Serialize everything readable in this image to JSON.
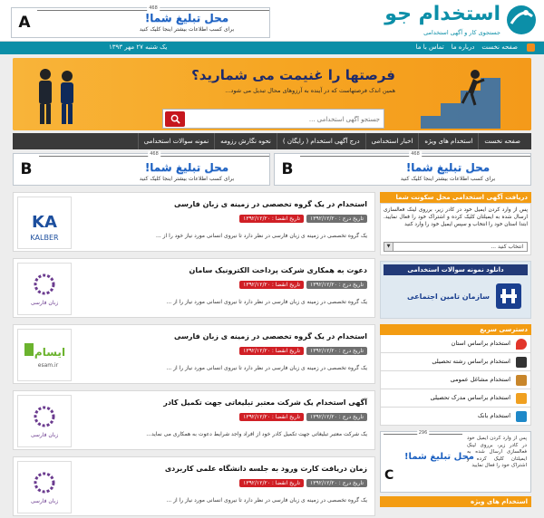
{
  "header": {
    "site_title": "استخدام جو",
    "site_subtitle": "جستجوی کار و آگهی استخدامی",
    "ad_a": {
      "letter": "A",
      "width_label": "468",
      "title": "محل تبلیغ شما!",
      "note": "برای کسب اطلاعات بیشتر اینجا کلیک کنید"
    }
  },
  "strip": {
    "links": [
      "صفحه نخست",
      "درباره ما",
      "تماس با ما"
    ],
    "date": "یک شنبه ۲۷ مهر ۱۳۹۳"
  },
  "hero": {
    "headline": "فرصتها را غنیمت می شمارید؟",
    "sub": "همین اندک فرصتهاست که در آینده به آرزوهای محال تبدیل می شود...",
    "search_placeholder": "جستجو آگهی استخدامی ..."
  },
  "nav": [
    "صفحه نخست",
    "استخدام های ویژه",
    "اخبار استخدامی",
    "درج آگهی استخدام ( رایگان )",
    "نحوه نگارش رزومه",
    "نمونه سوالات استخدامی"
  ],
  "ads_b": [
    {
      "letter": "B",
      "width_label": "468",
      "title": "محل تبلیغ شما!",
      "note": "برای کسب اطلاعات بیشتر اینجا کلیک کنید"
    },
    {
      "letter": "B",
      "width_label": "468",
      "title": "محل تبلیغ شما!",
      "note": "برای کسب اطلاعات بیشتر اینجا کلیک کنید"
    }
  ],
  "listings": [
    {
      "title": "استخدام در یک گروه تخصصی در زمینه ی زبان فارسی",
      "date_label": "تاریخ درج : ۱۳۹۲/۱۲/۲۰",
      "expire_label": "تاریخ انقضا : ۱۳۹۲/۱۲/۲۰",
      "desc": "یک گروه تخصصی در زمینه ی زبان فارسی در نظر دارد تا نیروی انسانی مورد نیاز خود را از ...",
      "logo": "KALBER"
    },
    {
      "title": "دعوت به همکاری شرکت پرداخت الکترونیک سامان",
      "date_label": "تاریخ درج : ۱۳۹۲/۱۲/۲۰",
      "expire_label": "تاریخ انقضا : ۱۳۹۲/۱۲/۲۰",
      "desc": "یک گروه تخصصی در زمینه ی زبان فارسی در نظر دارد تا نیروی انسانی مورد نیاز را از ...",
      "logo": "زبان فارسی"
    },
    {
      "title": "استخدام در یک گروه تخصصی در زمینه ی زبان فارسی",
      "date_label": "تاریخ درج : ۱۳۹۲/۱۲/۲۰",
      "expire_label": "تاریخ انقضا : ۱۳۹۲/۱۲/۲۰",
      "desc": "یک گروه تخصصی در زمینه ی زبان فارسی در نظر دارد تا نیروی انسانی مورد نیاز را از ...",
      "logo": "esam.ir"
    },
    {
      "title": "آگهی استخدام یک شرکت معتبر تبلیغاتی جهت تکمیل کادر",
      "date_label": "تاریخ درج : ۱۳۹۲/۱۲/۲۰",
      "expire_label": "تاریخ انقضا : ۱۳۹۲/۱۲/۲۰",
      "desc": "یک شرکت معتبر تبلیغاتی جهت تکمیل کادر خود از افراد واجد شرایط دعوت به همکاری می نماید...",
      "logo": "زبان فارسی"
    },
    {
      "title": "زمان دریافت کارت ورود به جلسه دانشگاه علمی کاربردی",
      "date_label": "تاریخ درج : ۱۳۹۲/۱۲/۲۰",
      "expire_label": "تاریخ انقضا : ۱۳۹۲/۱۲/۲۰",
      "desc": "یک گروه تخصصی در زمینه ی زبان فارسی در نظر دارد تا نیروی انسانی مورد نیاز را از ...",
      "logo": "زبان فارسی"
    }
  ],
  "sidebar": {
    "newsletter_head": "دریافت آگهی استخدامی محل سکونت شما",
    "newsletter_text": "پس از وارد کردن ایمیل خود در کادر زیر، برروی لینک فعالسازی ارسال شده به ایمیلتان کلیک کرده و اشتراک خود را فعال نمایید. ابتدا استان خود را انتخاب و سپس ایمیل خود را وارد کنید",
    "province_select": "انتخاب کنید ...",
    "sample_top": "دانلود نمونه سوالات استخدامی",
    "sample_org": "سازمان تامین اجتماعی",
    "quick_head": "دسترسی سریع",
    "quick_items": [
      "استخدام براساس استان",
      "استخدام براساس رشته تحصیلی",
      "استخدام مشاغل عمومی",
      "استخدام براساس مدرک تحصیلی",
      "استخدام بانک"
    ],
    "ad_c": {
      "letter": "C",
      "width_label": "296",
      "title": "محل تبلیغ شما!",
      "text": "پس از وارد کردن ایمیل خود در کادر زیر، برروی لینک فعالسازی ارسال شده به ایمیلتان کلیک کرده و اشتراک خود را فعال نمایید"
    },
    "special_head": "استخدام های ویژه"
  },
  "colors": {
    "brand": "#0b8ea7",
    "orange": "#f39c12",
    "red": "#d01f25"
  }
}
